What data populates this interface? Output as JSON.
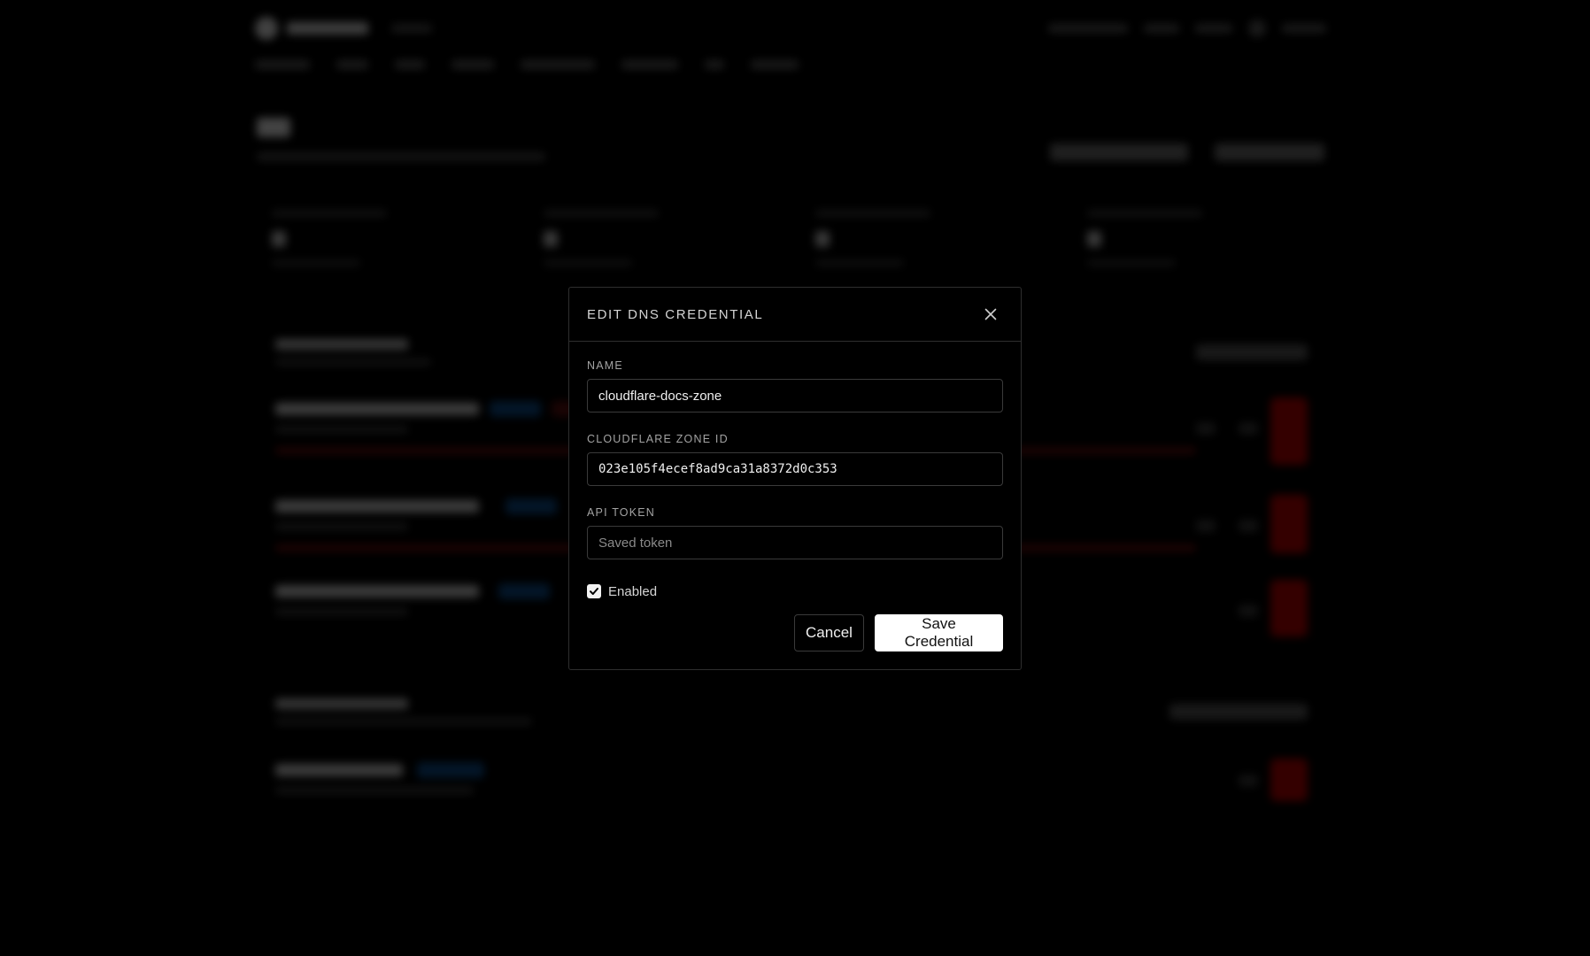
{
  "modal": {
    "title": "EDIT DNS CREDENTIAL",
    "fields": {
      "name": {
        "label": "NAME",
        "value": "cloudflare-docs-zone"
      },
      "zone_id": {
        "label": "CLOUDFLARE ZONE ID",
        "value": "023e105f4ecef8ad9ca31a8372d0c353"
      },
      "api_token": {
        "label": "API TOKEN",
        "value": "",
        "placeholder": "Saved token"
      }
    },
    "enabled": {
      "label": "Enabled",
      "checked": true
    },
    "buttons": {
      "cancel": "Cancel",
      "save": "Save Credential"
    }
  },
  "colors": {
    "background": "#000000",
    "modal_border": "#2e2e2e",
    "primary_button_bg": "#ffffff",
    "danger": "#b00000",
    "badge_blue": "#0e4a86"
  },
  "icons": {
    "close": "close-icon",
    "check": "check-icon"
  }
}
